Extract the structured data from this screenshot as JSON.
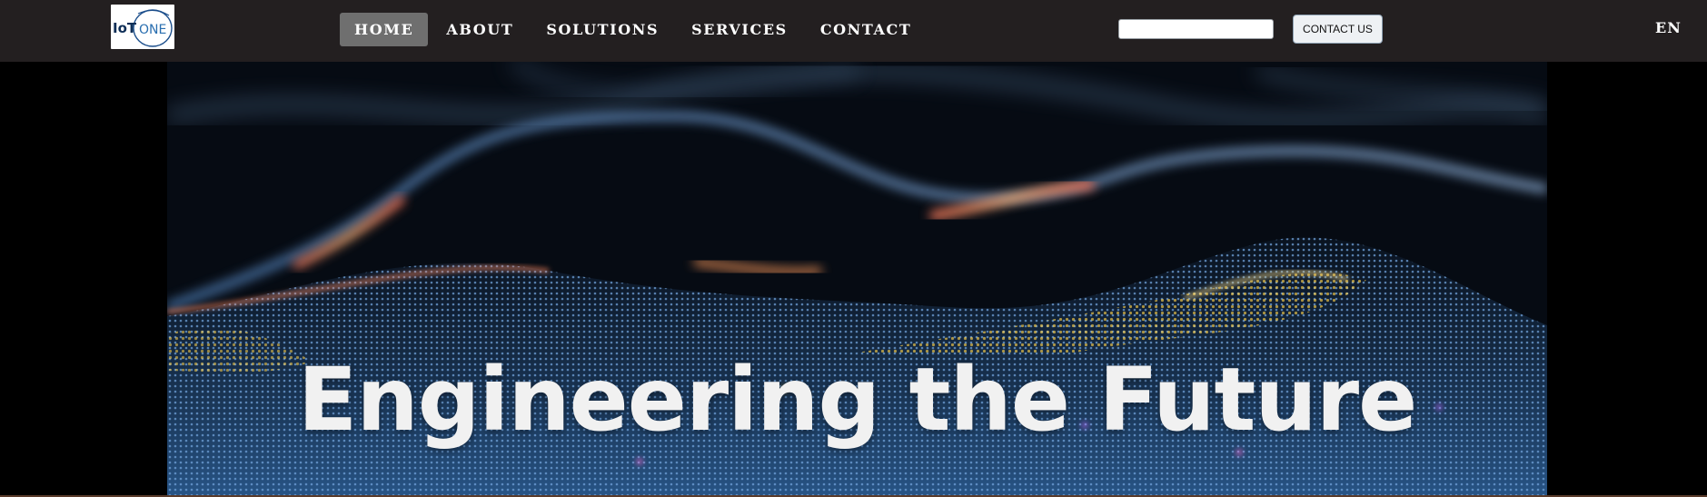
{
  "header": {
    "logo_text": "IoT ONE",
    "nav": [
      {
        "label": "HOME",
        "active": true
      },
      {
        "label": "ABOUT",
        "active": false
      },
      {
        "label": "SOLUTIONS",
        "active": false
      },
      {
        "label": "SERVICES",
        "active": false
      },
      {
        "label": "CONTACT",
        "active": false
      }
    ],
    "search": {
      "value": "",
      "placeholder": ""
    },
    "contact_button": "CONTACT US",
    "language": "EN"
  },
  "hero": {
    "title": "Engineering the Future"
  },
  "colors": {
    "topbar": "#231f20",
    "nav_active": "#6f6f6f",
    "logo_blue": "#1c4f8c",
    "hero_text": "#f1f1f1"
  }
}
